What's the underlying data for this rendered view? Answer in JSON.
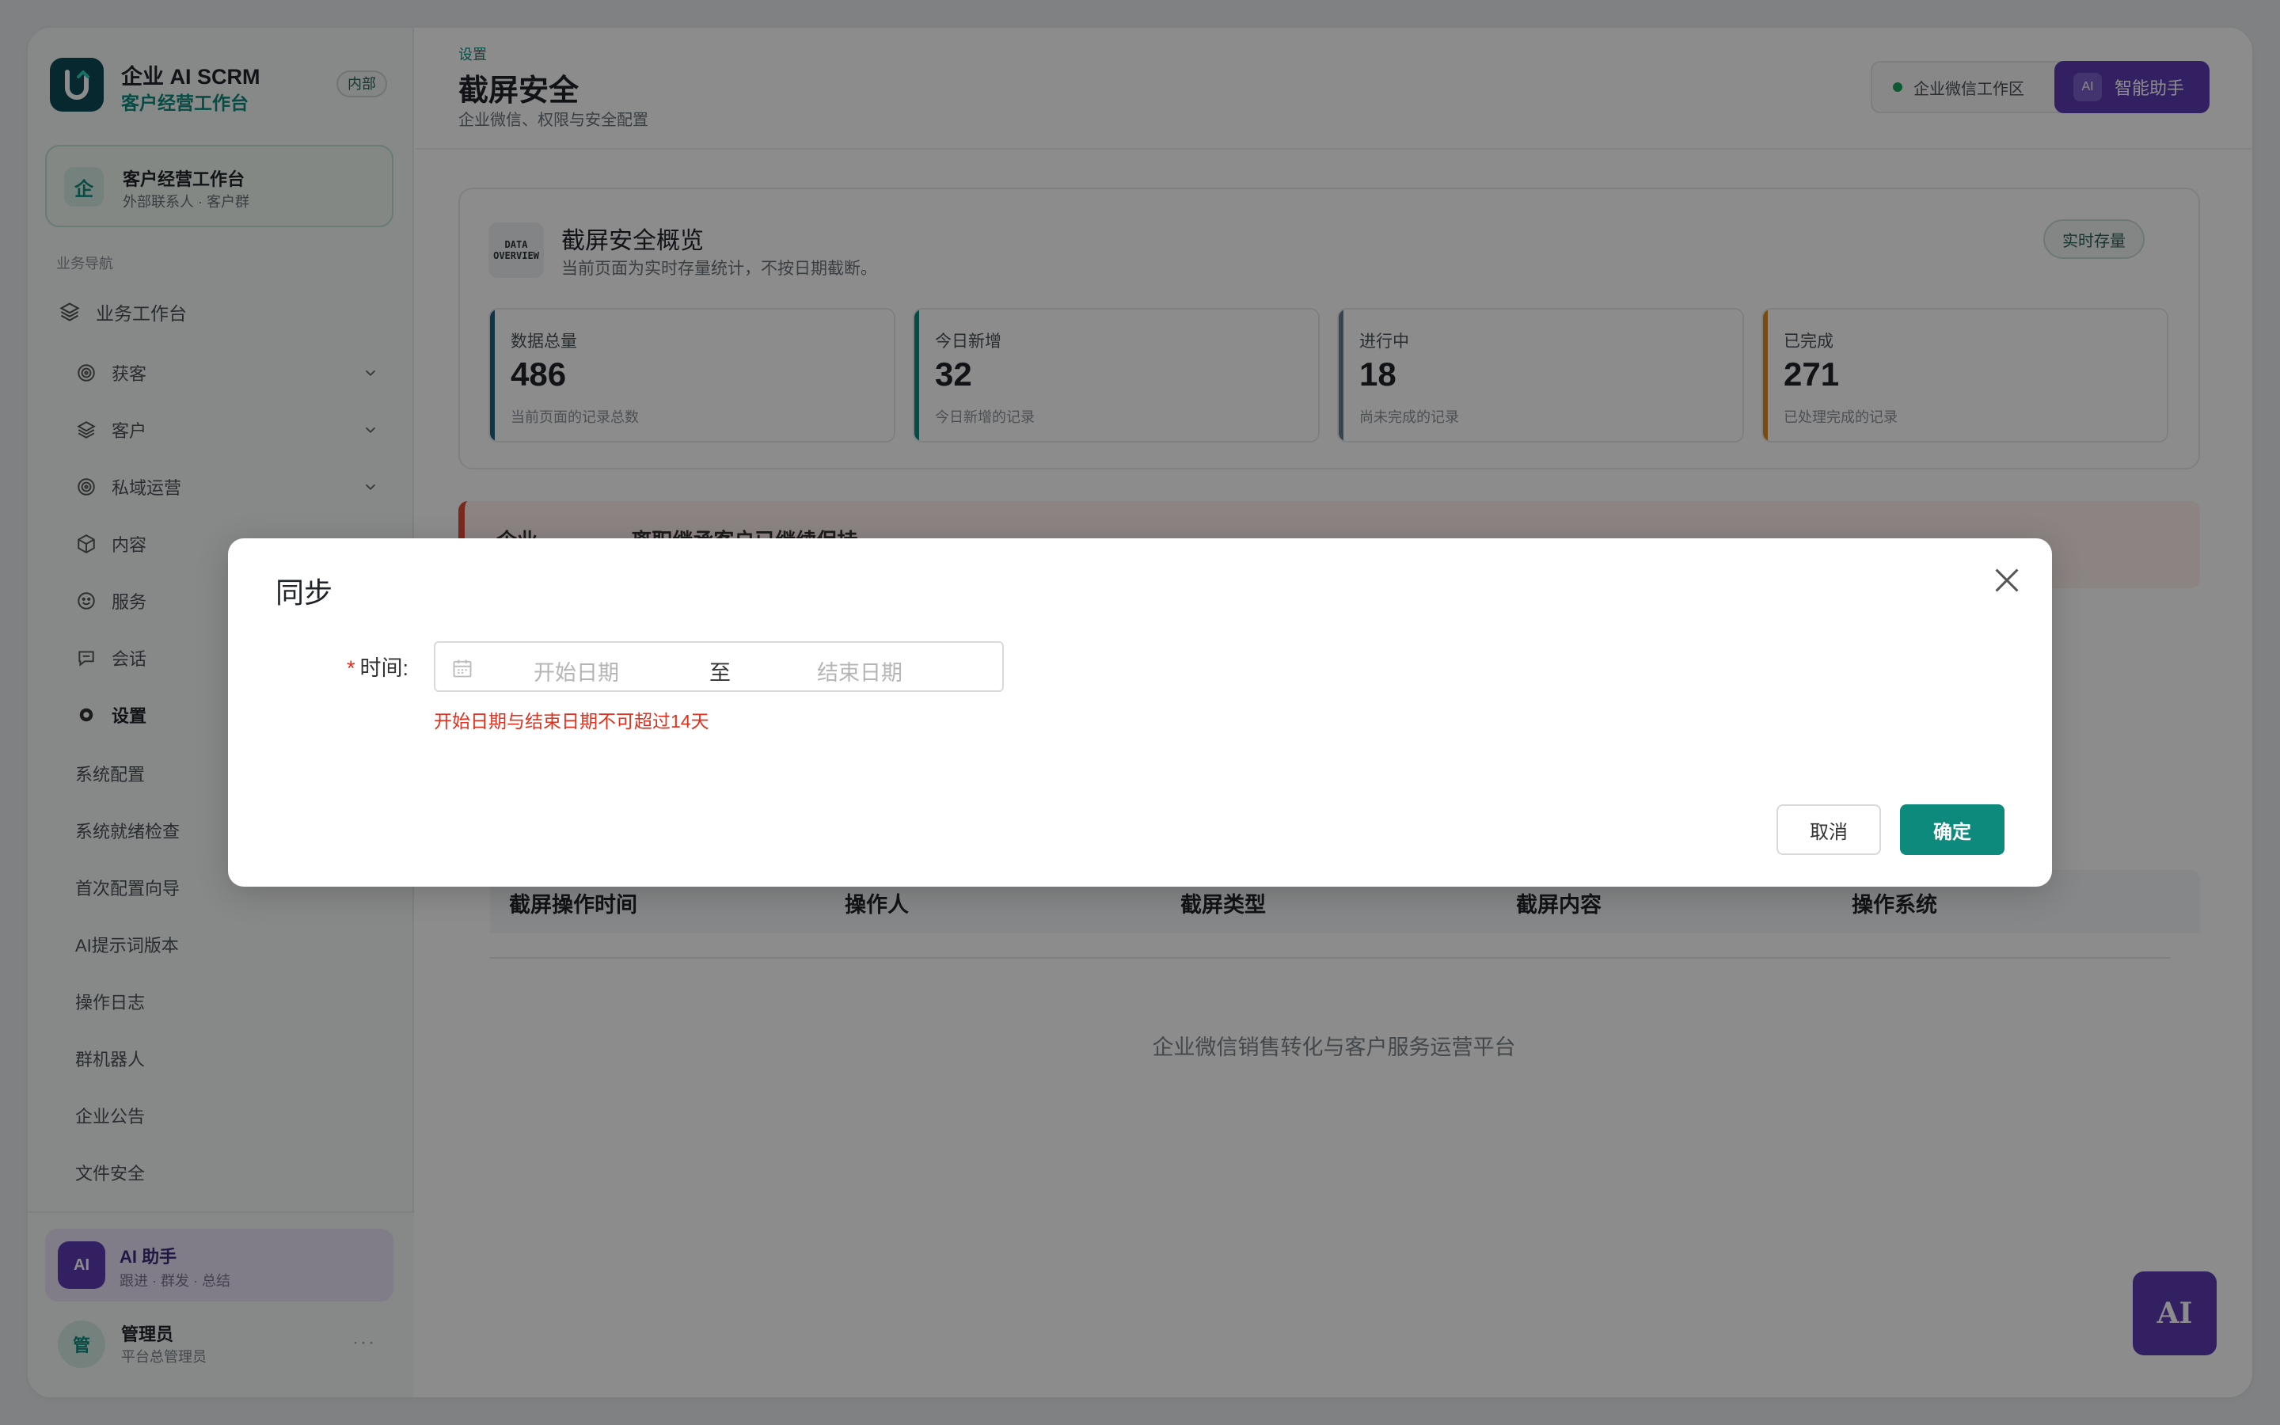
{
  "brand": {
    "title": "企业 AI SCRM",
    "subtitle": "客户经营工作台",
    "tag": "内部"
  },
  "workspace_card": {
    "icon": "企",
    "title": "客户经营工作台",
    "subtitle": "外部联系人 · 客户群"
  },
  "nav": {
    "section_label": "业务导航",
    "top_item": "业务工作台",
    "groups": [
      {
        "label": "获客",
        "icon": "target-icon",
        "expandable": true
      },
      {
        "label": "客户",
        "icon": "layers-icon",
        "expandable": true
      },
      {
        "label": "私域运营",
        "icon": "target-icon",
        "expandable": true
      },
      {
        "label": "内容",
        "icon": "cube-icon",
        "expandable": false
      },
      {
        "label": "服务",
        "icon": "smile-icon",
        "expandable": false
      },
      {
        "label": "会话",
        "icon": "chat-icon",
        "expandable": false
      },
      {
        "label": "设置",
        "icon": "settings-icon",
        "expandable": false
      }
    ],
    "settings_children": [
      "系统配置",
      "系统就绪检查",
      "首次配置向导",
      "AI提示词版本",
      "操作日志",
      "群机器人",
      "企业公告",
      "文件安全"
    ]
  },
  "ai_card": {
    "badge": "AI",
    "title": "AI 助手",
    "subtitle": "跟进 · 群发 · 总结"
  },
  "user": {
    "avatar": "管",
    "name": "管理员",
    "role": "平台总管理员",
    "more": "···"
  },
  "header": {
    "breadcrumb": "设置",
    "title": "截屏安全",
    "subtitle": "企业微信、权限与安全配置",
    "workspace_pill": "企业微信工作区",
    "ai_button": {
      "mini": "AI",
      "label": "智能助手"
    }
  },
  "overview": {
    "icon_text": "DATA OVERVIEW",
    "title": "截屏安全概览",
    "subtitle": "当前页面为实时存量统计，不按日期截断。",
    "badge": "实时存量",
    "stats": [
      {
        "label": "数据总量",
        "value": "486",
        "desc": "当前页面的记录总数",
        "color": "#1f5f86"
      },
      {
        "label": "今日新增",
        "value": "32",
        "desc": "今日新增的记录",
        "color": "#0e8a7c"
      },
      {
        "label": "进行中",
        "value": "18",
        "desc": "尚未完成的记录",
        "color": "#6b7c8a"
      },
      {
        "label": "已完成",
        "value": "271",
        "desc": "已处理完成的记录",
        "color": "#d98a1a"
      }
    ]
  },
  "alert": {
    "text": "企业 ············ 离职继承客户已继续保持"
  },
  "table": {
    "columns": [
      "截屏操作时间",
      "操作人",
      "截屏类型",
      "截屏内容",
      "操作系统"
    ],
    "empty_text": "企业微信销售转化与客户服务运营平台"
  },
  "fab": {
    "label": "AI"
  },
  "modal": {
    "title": "同步",
    "field_label": "时间:",
    "required_mark": "*",
    "start_placeholder": "开始日期",
    "separator": "至",
    "end_placeholder": "结束日期",
    "error": "开始日期与结束日期不可超过14天",
    "cancel": "取消",
    "ok": "确定"
  }
}
